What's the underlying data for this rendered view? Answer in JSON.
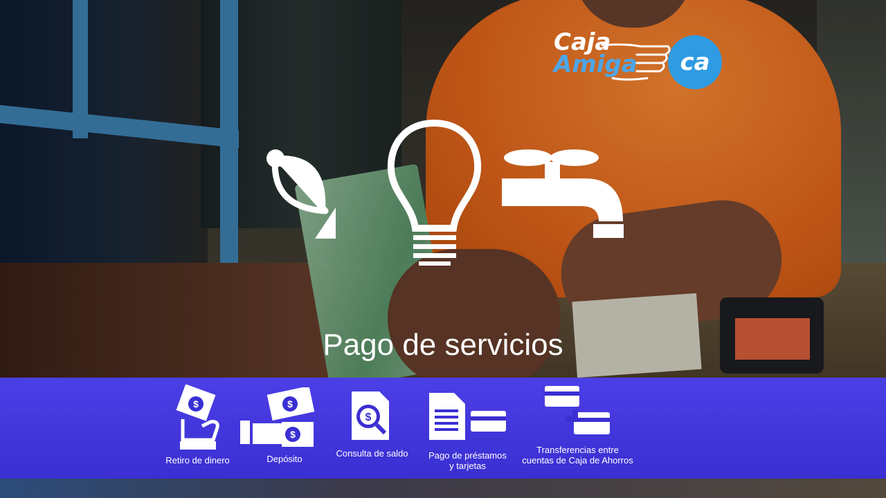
{
  "logo": {
    "line1": "Caja",
    "line2": "Amiga",
    "badge": "ca"
  },
  "headline": "Pago de servicios",
  "service_icons": [
    "satellite-dish-icon",
    "lightbulb-icon",
    "water-faucet-icon"
  ],
  "services": [
    {
      "icon": "cash-withdrawal-icon",
      "label": "Retiro de dinero"
    },
    {
      "icon": "deposit-icon",
      "label": "Depósito"
    },
    {
      "icon": "balance-inquiry-icon",
      "label": "Consulta de saldo"
    },
    {
      "icon": "loan-card-payment-icon",
      "label_line1": "Pago de préstamos",
      "label_line2": "y tarjetas"
    },
    {
      "icon": "transfer-icon",
      "label_line1": "Transferencias entre",
      "label_line2": "cuentas de Caja de Ahorros"
    }
  ],
  "colors": {
    "band": "#4b3fe6",
    "brand_blue": "#2f9be2",
    "shirt": "#f07a24"
  }
}
